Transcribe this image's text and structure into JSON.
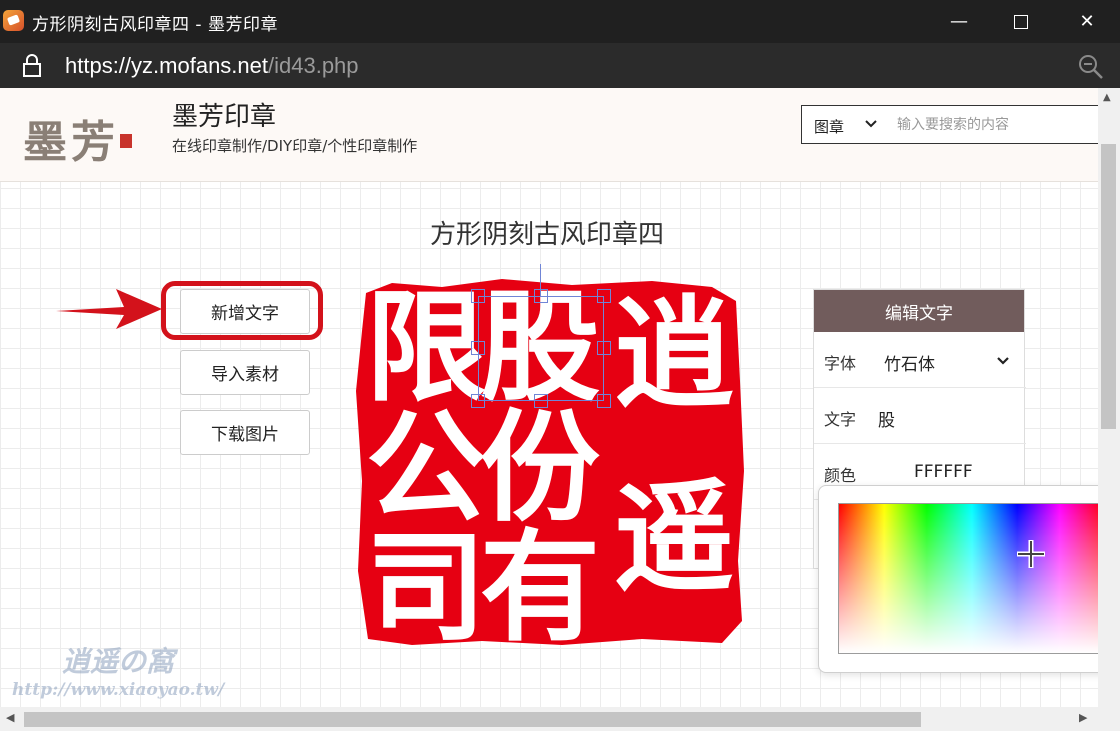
{
  "window": {
    "title": "方形阴刻古风印章四 - 墨芳印章",
    "minimize_glyph": "—",
    "close_glyph": "✕"
  },
  "address_bar": {
    "url_scheme": "https://",
    "url_host": "yz.mofans.net",
    "url_path": "/id43.php",
    "icons": [
      "lock-icon",
      "zoom-icon"
    ]
  },
  "header": {
    "logo_text": "墨芳",
    "site_name": "墨芳印章",
    "tagline": "在线印章制作/DIY印章/个性印章制作",
    "search": {
      "category": "图章",
      "placeholder": "输入要搜索的内容"
    }
  },
  "main": {
    "title": "方形阴刻古风印章四",
    "buttons": {
      "add_text": "新增文字",
      "import_material": "导入素材",
      "download_image": "下载图片"
    }
  },
  "seal": {
    "color": "#e60012",
    "characters": [
      "逍",
      "遥",
      "股",
      "份",
      "有",
      "限",
      "公",
      "司"
    ],
    "selected_character": "股"
  },
  "edit_panel": {
    "title": "编辑文字",
    "font_label": "字体",
    "font_value": "竹石体",
    "text_label": "文字",
    "text_value": "股",
    "color_label": "颜色",
    "color_value": "FFFFFF"
  },
  "watermark": {
    "name": "逍遥の窩",
    "url": "http://www.xiaoyao.tw/"
  },
  "colors": {
    "highlight": "#d3121b",
    "panel_header": "#715c5c"
  }
}
